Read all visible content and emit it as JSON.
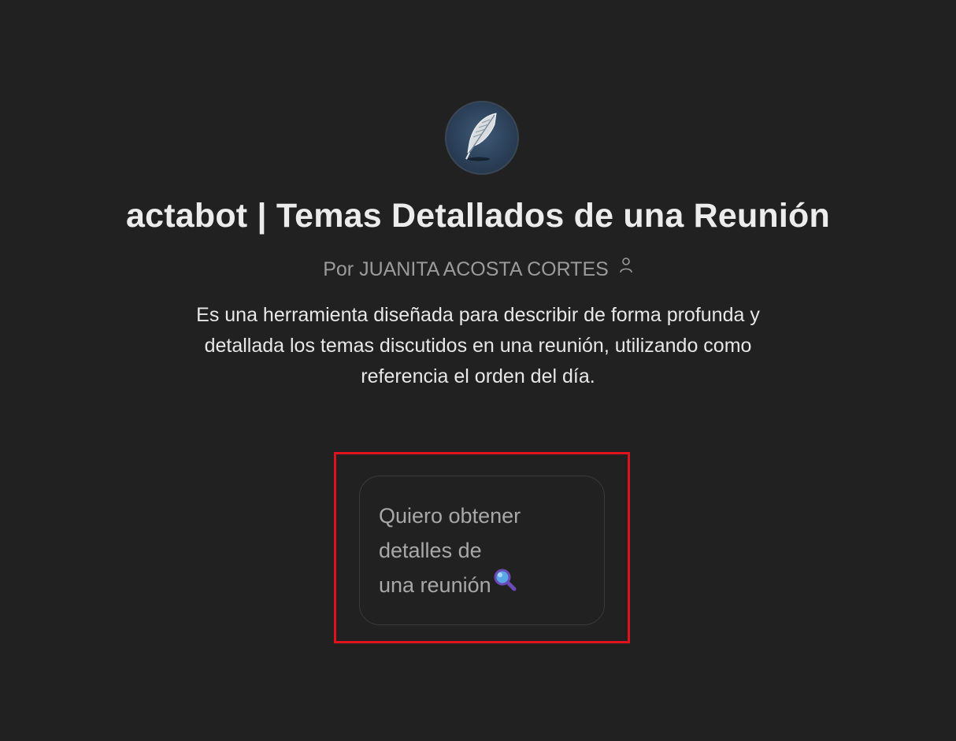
{
  "gpt": {
    "avatar_icon": "quill-feather-icon",
    "title": "actabot | Temas Detallados de una Reunión",
    "author_label": "Por JUANITA ACOSTA CORTES",
    "author_icon": "person-icon",
    "description": "Es una herramienta diseñada para describir de forma profunda y detallada los temas discutidos en una reunión, utilizando como referencia el orden del día."
  },
  "conversation_starters": [
    {
      "lines": [
        "Quiero obtener",
        "detalles de",
        "una reunión"
      ],
      "emoji_icon": "magnifying-glass-icon"
    }
  ],
  "colors": {
    "background": "#212121",
    "highlight": "#e0121b",
    "title": "#ececec",
    "muted": "#9b9b9b"
  }
}
